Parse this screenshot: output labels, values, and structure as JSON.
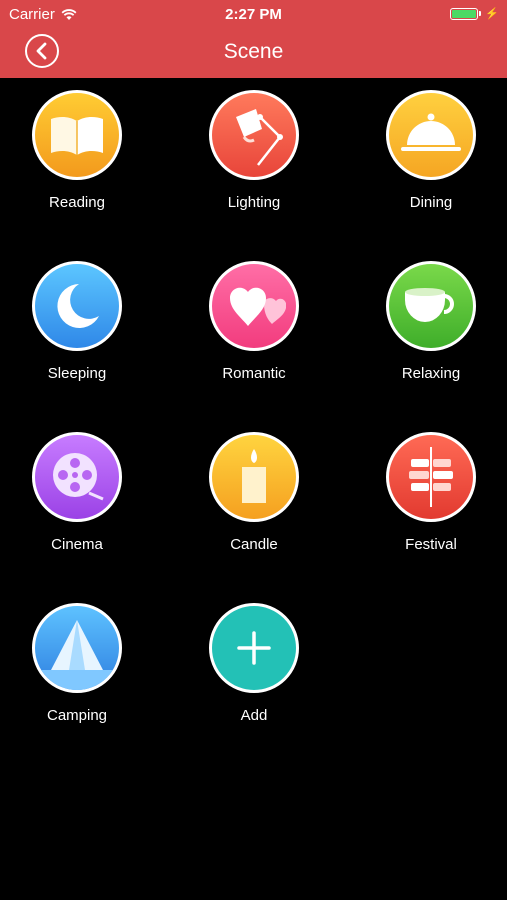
{
  "status_bar": {
    "carrier": "Carrier",
    "time": "2:27 PM"
  },
  "nav": {
    "title": "Scene"
  },
  "scenes": [
    {
      "label": "Reading",
      "icon": "book-icon",
      "color1": "#ffcc33",
      "color2": "#f39a1d"
    },
    {
      "label": "Lighting",
      "icon": "lamp-icon",
      "color1": "#ff7a5c",
      "color2": "#e8453a"
    },
    {
      "label": "Dining",
      "icon": "cloche-icon",
      "color1": "#ffd03f",
      "color2": "#f5a623"
    },
    {
      "label": "Sleeping",
      "icon": "moon-icon",
      "color1": "#5cc6ff",
      "color2": "#2f88e8"
    },
    {
      "label": "Romantic",
      "icon": "hearts-icon",
      "color1": "#ff6ea6",
      "color2": "#f23c7e"
    },
    {
      "label": "Relaxing",
      "icon": "teacup-icon",
      "color1": "#7ad94a",
      "color2": "#3fae2a"
    },
    {
      "label": "Cinema",
      "icon": "film-reel-icon",
      "color1": "#c77cff",
      "color2": "#9b42e6"
    },
    {
      "label": "Candle",
      "icon": "candle-icon",
      "color1": "#ffd43f",
      "color2": "#f5a020"
    },
    {
      "label": "Festival",
      "icon": "firecracker-icon",
      "color1": "#ff6a55",
      "color2": "#e23a30"
    },
    {
      "label": "Camping",
      "icon": "tent-icon",
      "color1": "#5ec2ff",
      "color2": "#2e7fe0"
    },
    {
      "label": "Add",
      "icon": "plus-icon",
      "color1": "#23c1b6",
      "color2": "#17aea3"
    }
  ]
}
